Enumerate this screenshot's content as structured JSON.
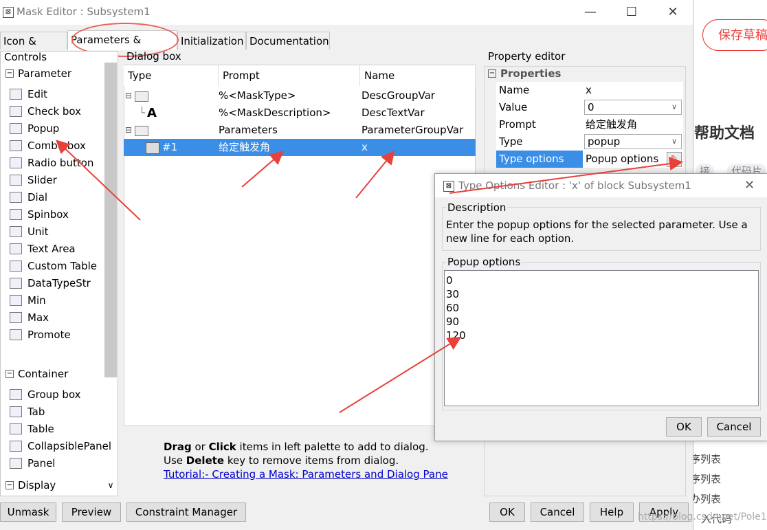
{
  "window": {
    "title": "Mask Editor : Subsystem1"
  },
  "background_page": {
    "save_draft": "保存草稿",
    "help_doc": "帮助文档",
    "tags": [
      "接",
      "代码片"
    ],
    "list_items": [
      "序列表",
      "序列表",
      "办列表",
      "入代码"
    ],
    "watermark": "https://blog.csdn.net/Pole1"
  },
  "tabs": [
    {
      "label": "Icon & Ports"
    },
    {
      "label": "Parameters & Dialog"
    },
    {
      "label": "Initialization"
    },
    {
      "label": "Documentation"
    }
  ],
  "controls": {
    "title": "Controls",
    "parameter_section": "Parameter",
    "parameter_items": [
      {
        "label": "Edit",
        "icon": "edit-icon"
      },
      {
        "label": "Check box",
        "icon": "checkbox-icon"
      },
      {
        "label": "Popup",
        "icon": "popup-icon"
      },
      {
        "label": "Combo box",
        "icon": "combobox-icon"
      },
      {
        "label": "Radio button",
        "icon": "radio-icon"
      },
      {
        "label": "Slider",
        "icon": "slider-icon"
      },
      {
        "label": "Dial",
        "icon": "dial-icon"
      },
      {
        "label": "Spinbox",
        "icon": "spinbox-icon"
      },
      {
        "label": "Unit",
        "icon": "unit-icon"
      },
      {
        "label": "Text Area",
        "icon": "textarea-icon"
      },
      {
        "label": "Custom Table",
        "icon": "table-icon"
      },
      {
        "label": "DataTypeStr",
        "icon": "datatype-icon"
      },
      {
        "label": "Min",
        "icon": "min-icon"
      },
      {
        "label": "Max",
        "icon": "max-icon"
      },
      {
        "label": "Promote",
        "icon": "promote-icon"
      }
    ],
    "container_section": "Container",
    "container_items": [
      {
        "label": "Group box",
        "icon": "groupbox-icon"
      },
      {
        "label": "Tab",
        "icon": "tab-icon"
      },
      {
        "label": "Table",
        "icon": "table-icon"
      },
      {
        "label": "CollapsiblePanel",
        "icon": "collapsible-icon"
      },
      {
        "label": "Panel",
        "icon": "panel-icon"
      }
    ],
    "display_section": "Display"
  },
  "dialog_box": {
    "title": "Dialog box",
    "columns": [
      "Type",
      "Prompt",
      "Name"
    ],
    "rows": [
      {
        "type": "",
        "prompt": "%<MaskType>",
        "name": "DescGroupVar"
      },
      {
        "type": "A",
        "prompt": "%<MaskDescription>",
        "name": "DescTextVar"
      },
      {
        "type": "",
        "prompt": "Parameters",
        "name": "ParameterGroupVar"
      },
      {
        "type": "#1",
        "prompt": "给定触发角",
        "name": "x"
      }
    ],
    "help_line1_bold1": "Drag",
    "help_line1_or": " or ",
    "help_line1_bold2": "Click",
    "help_line1_rest": " items in left palette to add to dialog.",
    "help_line2_use": "Use ",
    "help_line2_bold": "Delete",
    "help_line2_rest": " key to remove items from dialog.",
    "tutorial_link": "Tutorial:- Creating a Mask: Parameters and Dialog Pane"
  },
  "property_editor": {
    "title": "Property editor",
    "section": "Properties",
    "rows": [
      {
        "key": "Name",
        "value": "x"
      },
      {
        "key": "Value",
        "value": "0"
      },
      {
        "key": "Prompt",
        "value": "给定触发角"
      },
      {
        "key": "Type",
        "value": "popup"
      },
      {
        "key": "Type options",
        "value": "Popup options"
      }
    ]
  },
  "popup_editor": {
    "title": "Type Options Editor : 'x' of block Subsystem1",
    "description_label": "Description",
    "description_text_1": "Enter the popup options for the selected parameter. Use a",
    "description_text_2": "new line for each option.",
    "options_label": "Popup options",
    "options": [
      "0",
      "30",
      "60",
      "90",
      "120"
    ],
    "ok": "OK",
    "cancel": "Cancel"
  },
  "bottom_buttons": {
    "unmask": "Unmask",
    "preview": "Preview",
    "constraint_manager": "Constraint Manager",
    "ok": "OK",
    "cancel": "Cancel",
    "help": "Help",
    "apply": "Apply"
  },
  "colors": {
    "selection": "#3a8ee6",
    "annotation": "#e8615a",
    "link": "#0000cc"
  }
}
